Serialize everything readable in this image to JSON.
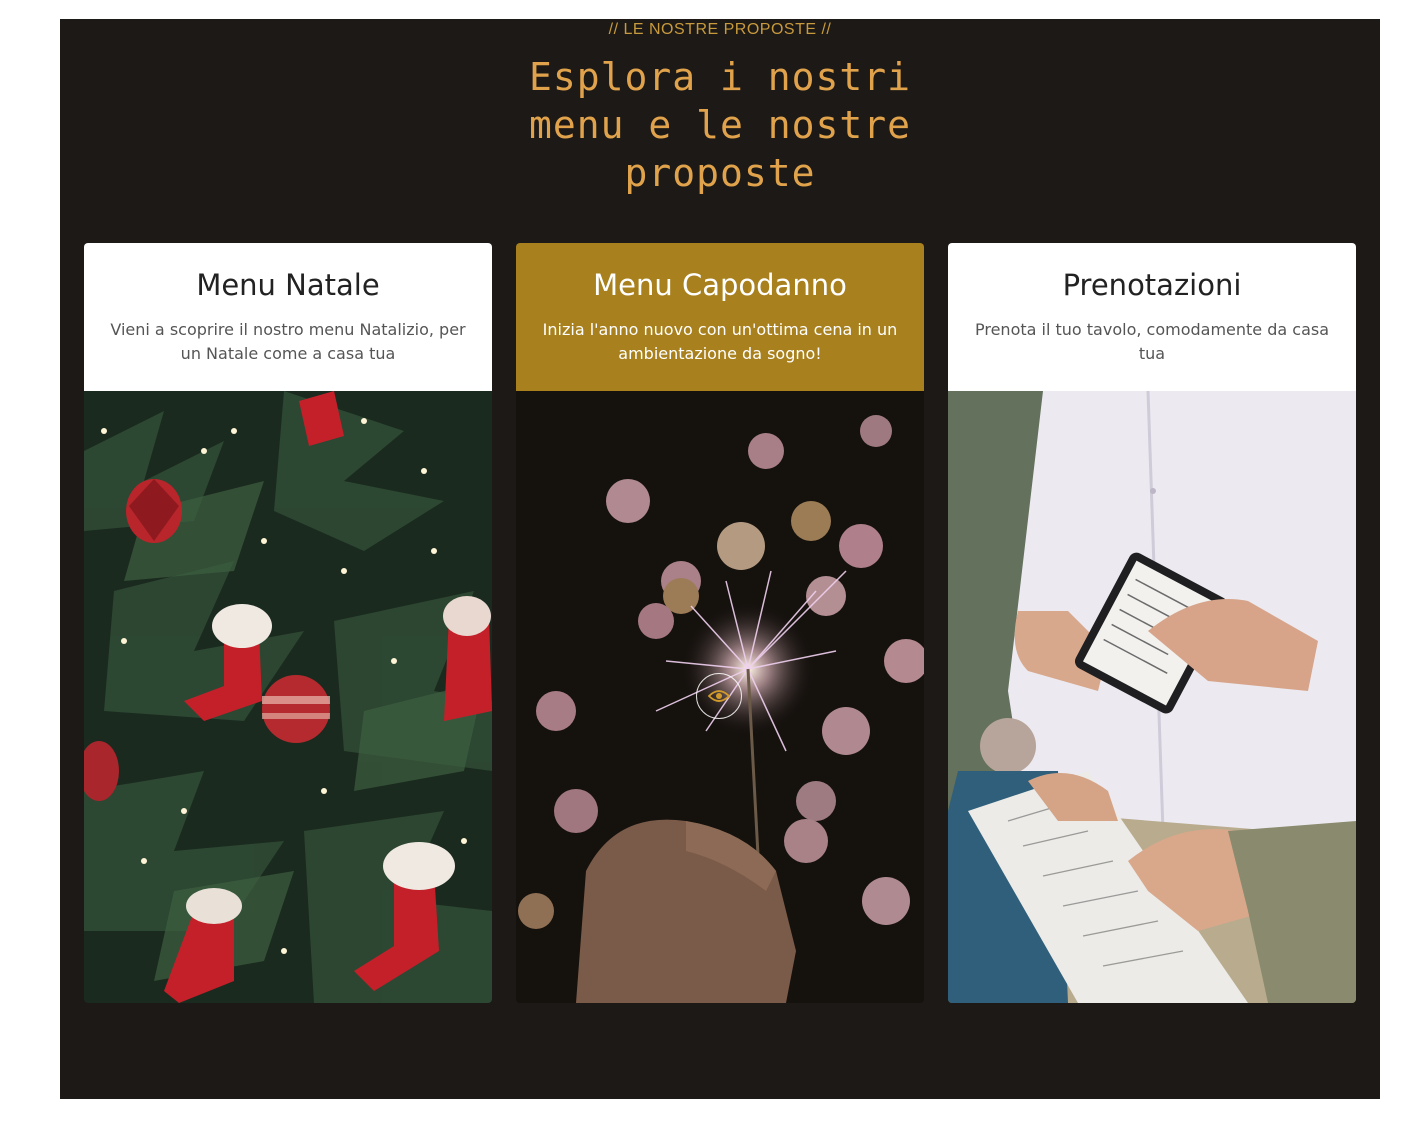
{
  "section": {
    "eyebrow": "// LE NOSTRE PROPOSTE //",
    "title": "Esplora i nostri menu e le nostre proposte"
  },
  "cards": [
    {
      "title": "Menu Natale",
      "description": "Vieni a scoprire il nostro menu Natalizio, per un Natale come a casa tua",
      "image": "christmas-tree-photo"
    },
    {
      "title": "Menu Capodanno",
      "description": "Inizia l'anno nuovo con un'ottima cena in un ambientazione da sogno!",
      "image": "sparkler-photo",
      "overlay_icon": "eye-icon"
    },
    {
      "title": "Prenotazioni",
      "description": "Prenota il tuo tavolo, comodamente da casa tua",
      "image": "waiter-notepad-photo"
    }
  ],
  "colors": {
    "section_bg": "#1d1917",
    "accent_gold": "#a8801d",
    "title_gold": "#e0a34c"
  }
}
